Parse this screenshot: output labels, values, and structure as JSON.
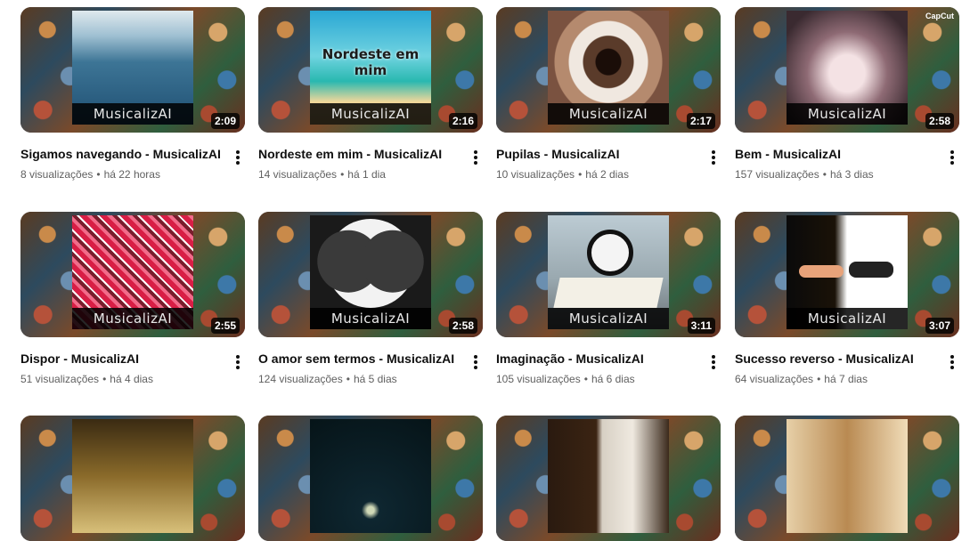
{
  "icons": {
    "menu": "more-vert-icon"
  },
  "videos": [
    {
      "title": "Sigamos navegando - MusicalizAI",
      "views": "8 visualizações",
      "age": "há 22 horas",
      "duration": "2:09",
      "watermark": "MusicalizAI",
      "art": "art-sea"
    },
    {
      "title": "Nordeste em mim - MusicalizAI",
      "views": "14 visualizações",
      "age": "há 1 dia",
      "duration": "2:16",
      "watermark": "MusicalizAI",
      "art": "art-beach",
      "overlay": "Nordeste em mim"
    },
    {
      "title": "Pupilas - MusicalizAI",
      "views": "10 visualizações",
      "age": "há 2 dias",
      "duration": "2:17",
      "watermark": "MusicalizAI",
      "art": "art-eye"
    },
    {
      "title": "Bem - MusicalizAI",
      "views": "157 visualizações",
      "age": "há 3 dias",
      "duration": "2:58",
      "watermark": "MusicalizAI",
      "art": "art-heartlight",
      "badge": "CapCut"
    },
    {
      "title": "Dispor - MusicalizAI",
      "views": "51 visualizações",
      "age": "há 4 dias",
      "duration": "2:55",
      "watermark": "MusicalizAI",
      "art": "art-wall"
    },
    {
      "title": "O amor sem termos - MusicalizAI",
      "views": "124 visualizações",
      "age": "há 5 dias",
      "duration": "2:58",
      "watermark": "MusicalizAI",
      "art": "art-whiteheart"
    },
    {
      "title": "Imaginação - MusicalizAI",
      "views": "105 visualizações",
      "age": "há 6 dias",
      "duration": "3:11",
      "watermark": "MusicalizAI",
      "art": "art-clock"
    },
    {
      "title": "Sucesso reverso - MusicalizAI",
      "views": "64 visualizações",
      "age": "há 7 dias",
      "duration": "3:07",
      "watermark": "MusicalizAI",
      "art": "art-hands"
    }
  ],
  "partial_row": [
    {
      "art": "art-room"
    },
    {
      "art": "art-dark"
    },
    {
      "art": "art-curtain"
    },
    {
      "art": "art-guitar"
    }
  ]
}
